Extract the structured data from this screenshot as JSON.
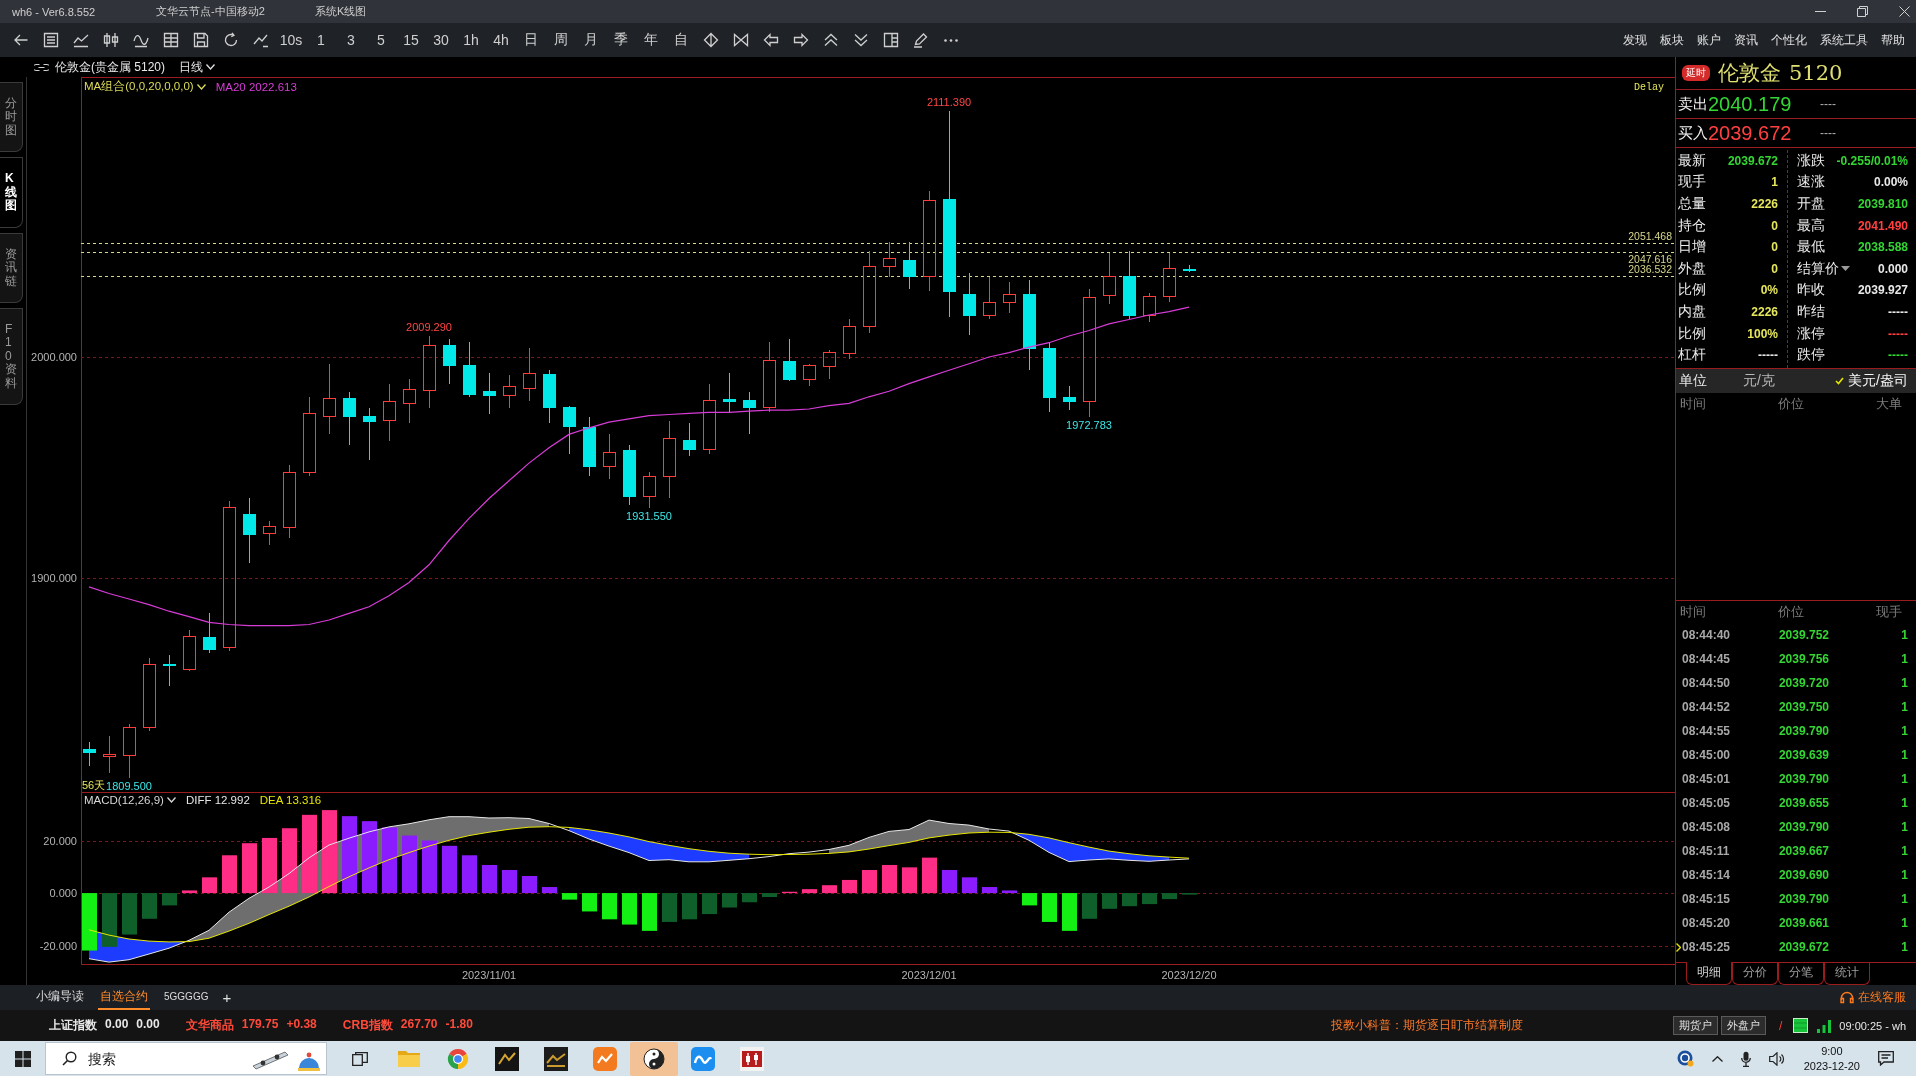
{
  "title_bar": {
    "app_version": "wh6 - Ver6.8.552",
    "server": "文华云节点-中国移动2",
    "window_title": "系统K线图"
  },
  "toolbar": {
    "intervals": [
      "10s",
      "1",
      "3",
      "5",
      "15",
      "30",
      "1h",
      "4h",
      "日",
      "周",
      "月",
      "季",
      "年",
      "自"
    ],
    "menu": [
      "发现",
      "板块",
      "账户",
      "资讯",
      "个性化",
      "系统工具",
      "帮助"
    ]
  },
  "chart": {
    "symbol": "伦敦金(贵金属 5120)",
    "period": "日线",
    "side_tabs": [
      {
        "label": "分时图",
        "selected": false
      },
      {
        "label": "K线图",
        "selected": true
      },
      {
        "label": "资讯链",
        "selected": false
      },
      {
        "label": "F10资料",
        "selected": false
      }
    ],
    "price_legend": {
      "indicator": "MA组合(0,0,20,0,0,0)",
      "readings": [
        "MA20 2022.613"
      ]
    },
    "macd_legend": {
      "indicator": "MACD(12,26,9)",
      "readings": [
        "DIFF 12.992",
        "DEA 13.316"
      ]
    },
    "chart_data": [
      {
        "type": "candlestick",
        "ylim": [
          1803.2,
          2126.7
        ],
        "yticks": [
          {
            "value": 1900,
            "label": "1900.000"
          },
          {
            "value": 2000,
            "label": "2000.000"
          }
        ],
        "grid": true,
        "ohlc": [
          [
            1822.5,
            1826,
            1815,
            1821.5
          ],
          [
            1819.5,
            1828.5,
            1812,
            1820.5
          ],
          [
            1820,
            1834,
            1809.5,
            1832.6
          ],
          [
            1832.6,
            1864,
            1831,
            1861
          ],
          [
            1861,
            1865,
            1851,
            1860.5
          ],
          [
            1859,
            1876.5,
            1858,
            1874
          ],
          [
            1873.5,
            1884,
            1866,
            1868
          ],
          [
            1869,
            1935,
            1867,
            1932
          ],
          [
            1929,
            1936,
            1907,
            1920
          ],
          [
            1920.5,
            1926,
            1915,
            1923.5
          ],
          [
            1923,
            1951,
            1918,
            1948
          ],
          [
            1948,
            1982,
            1946,
            1974.5
          ],
          [
            1973.5,
            1997,
            1965,
            1981.5
          ],
          [
            1981.5,
            1984,
            1960,
            1973.5
          ],
          [
            1973.5,
            1977,
            1953.5,
            1971
          ],
          [
            1971.5,
            1988,
            1962,
            1980
          ],
          [
            1979,
            1990,
            1970,
            1985.5
          ],
          [
            1985,
            2009.29,
            1977,
            2005.5
          ],
          [
            2005.5,
            2008,
            1988,
            1996.5
          ],
          [
            1996.5,
            2007,
            1982,
            1983.5
          ],
          [
            1984.5,
            1993,
            1974,
            1983
          ],
          [
            1983,
            1992,
            1977,
            1987
          ],
          [
            1986,
            2004,
            1980,
            1993
          ],
          [
            1992.5,
            1994,
            1970,
            1977.5
          ],
          [
            1977.5,
            1978,
            1956,
            1969
          ],
          [
            1968.5,
            1973,
            1946,
            1950.5
          ],
          [
            1950.5,
            1965,
            1945,
            1957
          ],
          [
            1958,
            1960,
            1933,
            1937
          ],
          [
            1937,
            1948,
            1931.55,
            1946
          ],
          [
            1946,
            1971,
            1936,
            1963.5
          ],
          [
            1962.5,
            1970,
            1955,
            1958.5
          ],
          [
            1958.5,
            1988,
            1956,
            1980.5
          ],
          [
            1981,
            1993,
            1975,
            1980
          ],
          [
            1980.5,
            1984,
            1965,
            1977.5
          ],
          [
            1977.5,
            2007,
            1975,
            1998.5
          ],
          [
            1998,
            2008,
            1989,
            1990
          ],
          [
            1990,
            1997,
            1987,
            1996.5
          ],
          [
            1996,
            2003,
            1990,
            2002.5
          ],
          [
            2002,
            2017,
            1999,
            2014
          ],
          [
            2014,
            2048,
            2011,
            2041
          ],
          [
            2041,
            2052,
            2036,
            2045
          ],
          [
            2044,
            2052,
            2031,
            2036.5
          ],
          [
            2036.5,
            2075,
            2030,
            2071
          ],
          [
            2071.5,
            2111.39,
            2018,
            2029.8
          ],
          [
            2028.5,
            2038,
            2010,
            2019
          ],
          [
            2019,
            2036,
            2017,
            2025
          ],
          [
            2025,
            2034,
            2020,
            2028.5
          ],
          [
            2028.5,
            2035,
            1994,
            2004
          ],
          [
            2004,
            2007,
            1975,
            1982
          ],
          [
            1982,
            1987,
            1976,
            1980
          ],
          [
            1980,
            2031,
            1972.783,
            2027
          ],
          [
            2028,
            2047,
            2024,
            2036.5
          ],
          [
            2036.5,
            2048,
            2017,
            2019
          ],
          [
            2019,
            2029,
            2016,
            2027.5
          ],
          [
            2027.5,
            2047,
            2025,
            2040.5
          ],
          [
            2039.81,
            2041.49,
            2038.588,
            2039.672
          ]
        ],
        "series": [
          {
            "type": "line",
            "color": "#d83cd8",
            "values": [
              1896,
              1893,
              1890.5,
              1888,
              1885,
              1882.5,
              1880,
              1879,
              1878.5,
              1878.5,
              1878.5,
              1879,
              1881,
              1884,
              1887,
              1892,
              1898,
              1906,
              1917,
              1927,
              1936,
              1944,
              1952,
              1959,
              1965,
              1968,
              1970.5,
              1972,
              1973.5,
              1974,
              1974.5,
              1975,
              1975,
              1975.5,
              1976,
              1976,
              1976.5,
              1978,
              1979,
              1982,
              1984.5,
              1988,
              1991,
              1994,
              1997,
              2000,
              2002,
              2004.5,
              2006.5,
              2009.5,
              2012,
              2015,
              2017,
              2019,
              2020.5,
              2022.6
            ]
          }
        ],
        "ref_lines": [
          {
            "axis": "y",
            "value": 2051.468,
            "label": "2051.468",
            "color": "#d6d68c",
            "line_style": "dashed"
          },
          {
            "axis": "y",
            "value": 2047.616,
            "label": "2047.616",
            "color": "#d6d68c",
            "line_style": "dashed"
          },
          {
            "axis": "y",
            "value": 2036.532,
            "label": "2036.532",
            "color": "#d6d68c",
            "line_style": "dashed"
          }
        ],
        "annotations": [
          "2111.390",
          "2009.290",
          "1931.550",
          "1972.783",
          "1809.500",
          "56天",
          "Delay"
        ]
      },
      {
        "type": "bar",
        "categories": [
          null,
          null,
          null,
          null,
          null,
          null,
          null,
          null,
          null,
          null,
          null,
          null,
          null,
          null,
          null,
          null,
          null,
          null,
          null,
          null,
          "2023/11/01",
          null,
          null,
          null,
          null,
          null,
          null,
          null,
          null,
          null,
          null,
          null,
          null,
          null,
          null,
          null,
          null,
          null,
          null,
          null,
          null,
          null,
          "2023/12/01",
          null,
          null,
          null,
          null,
          null,
          null,
          null,
          null,
          null,
          null,
          null,
          null,
          "2023/12/20"
        ],
        "ylim": [
          -27.4,
          38.5
        ],
        "yticks": [
          {
            "value": 20,
            "label": "20.000"
          },
          {
            "value": 0,
            "label": "0.000"
          },
          {
            "value": -20,
            "label": "-20.000"
          }
        ],
        "grid": true,
        "series": [
          {
            "values": [
              -21.9,
              -20.5,
              -15.8,
              -9.8,
              -4.7,
              1,
              6,
              14.4,
              19,
              21,
              24.7,
              29.8,
              31.6,
              29.3,
              27.4,
              25,
              21.9,
              20,
              18,
              14.4,
              10.7,
              8.8,
              6.5,
              2.3,
              -2.5,
              -7,
              -10,
              -12,
              -14.4,
              -11,
              -10,
              -8,
              -5.5,
              -3.5,
              -1.5,
              0.5,
              1.5,
              3,
              5,
              8.8,
              10.7,
              9.8,
              13.5,
              8.8,
              6,
              2.3,
              1,
              -4.7,
              -11,
              -14.4,
              -9.8,
              -6,
              -5,
              -4.2,
              -2.3,
              -0.6
            ],
            "colors": [
              "#14f014",
              "#0f5f2a",
              "#0f5f2a",
              "#0f5f2a",
              "#0f5f2a",
              "#ff2d86",
              "#ff2d86",
              "#ff2d86",
              "#ff2d86",
              "#ff2d86",
              "#ff2d86",
              "#ff2d86",
              "#ff2d86",
              "#8b1cff",
              "#8b1cff",
              "#8b1cff",
              "#8b1cff",
              "#8b1cff",
              "#8b1cff",
              "#8b1cff",
              "#8b1cff",
              "#8b1cff",
              "#8b1cff",
              "#8b1cff",
              "#14f014",
              "#14f014",
              "#14f014",
              "#14f014",
              "#14f014",
              "#0f5f2a",
              "#0f5f2a",
              "#0f5f2a",
              "#0f5f2a",
              "#0f5f2a",
              "#0f5f2a",
              "#ff2d86",
              "#ff2d86",
              "#ff2d86",
              "#ff2d86",
              "#ff2d86",
              "#ff2d86",
              "#ff2d86",
              "#ff2d86",
              "#8b1cff",
              "#8b1cff",
              "#8b1cff",
              "#8b1cff",
              "#14f014",
              "#14f014",
              "#14f014",
              "#0f5f2a",
              "#0f5f2a",
              "#0f5f2a",
              "#0f5f2a",
              "#0f5f2a",
              "#0f5f2a"
            ]
          },
          {
            "type": "line",
            "color": "#e6e6e6",
            "values": [
              -25,
              -26.3,
              -25.4,
              -23.2,
              -21,
              -18,
              -14.2,
              -7.3,
              -2,
              2.3,
              7.4,
              13.4,
              18.3,
              20.9,
              23.3,
              25.2,
              26.4,
              27.9,
              29.1,
              29.1,
              28.6,
              28.7,
              28.4,
              26.5,
              23.8,
              20.6,
              17.9,
              15.4,
              12.4,
              12.7,
              11.9,
              11.9,
              12.5,
              13.1,
              13.9,
              15,
              15.6,
              16.6,
              18.2,
              21.2,
              23.5,
              24.2,
              27.8,
              26.5,
              25.9,
              24.4,
              23.6,
              20.1,
              15.5,
              12,
              12.6,
              13,
              12.5,
              12.1,
              12.6,
              13
            ]
          },
          {
            "type": "line",
            "color": "#e6e600",
            "values": [
              -14,
              -16,
              -17.5,
              -18.3,
              -18.6,
              -18.5,
              -17.2,
              -14.5,
              -11.5,
              -8.2,
              -5,
              -1.5,
              2.5,
              6.2,
              9.6,
              12.7,
              15.4,
              17.9,
              20.1,
              21.9,
              23.2,
              24.3,
              25.1,
              25.3,
              25,
              24.1,
              22.9,
              21.4,
              19.6,
              18.2,
              16.9,
              15.9,
              15.2,
              14.8,
              14.6,
              14.7,
              14.8,
              15.1,
              15.7,
              16.8,
              18.1,
              19.3,
              21,
              22.1,
              22.9,
              23.2,
              23.1,
              22.4,
              21,
              19.2,
              17.5,
              16,
              15,
              14.2,
              13.7,
              13.3
            ]
          }
        ]
      }
    ]
  },
  "quote_panel": {
    "badge": "延时",
    "name": "伦敦金",
    "code": "5120",
    "quotes": [
      {
        "label": "卖出",
        "price": "2040.179",
        "size": "----",
        "color": "#33d633"
      },
      {
        "label": "买入",
        "price": "2039.672",
        "size": "----",
        "color": "#ff4040"
      }
    ],
    "left_stats": [
      {
        "label": "最新",
        "value": "2039.672",
        "color": "#33d633"
      },
      {
        "label": "现手",
        "value": "1",
        "color": "#e6e65c"
      },
      {
        "label": "总量",
        "value": "2226",
        "color": "#e6e65c"
      },
      {
        "label": "持仓",
        "value": "0",
        "color": "#e6e65c"
      },
      {
        "label": "日增",
        "value": "0",
        "color": "#e6e65c"
      },
      {
        "label": "外盘",
        "value": "0",
        "color": "#e6e65c"
      },
      {
        "label": "比例",
        "value": "0%",
        "color": "#e6e65c"
      },
      {
        "label": "内盘",
        "value": "2226",
        "color": "#e6e65c"
      },
      {
        "label": "比例",
        "value": "100%",
        "color": "#e6e65c"
      },
      {
        "label": "杠杆",
        "value": "-----",
        "color": "#e8e8e8"
      }
    ],
    "right_stats": [
      {
        "label": "涨跌",
        "value": "-0.255/0.01%",
        "color": "#33d633",
        "kind": "plain"
      },
      {
        "label": "速涨",
        "value": "0.00%",
        "color": "#e8e8e8",
        "kind": "plain"
      },
      {
        "label": "开盘",
        "value": "2039.810",
        "color": "#33d633",
        "kind": "plain"
      },
      {
        "label": "最高",
        "value": "2041.490",
        "color": "#ff4040",
        "kind": "plain"
      },
      {
        "label": "最低",
        "value": "2038.588",
        "color": "#33d633",
        "kind": "plain"
      },
      {
        "label": "结算价",
        "value": "0.000",
        "color": "#e8e8e8",
        "kind": "dropdown"
      },
      {
        "label": "昨收",
        "value": "2039.927",
        "color": "#e8e8e8",
        "kind": "plain"
      },
      {
        "label": "昨结",
        "value": "-----",
        "color": "#e8e8e8",
        "kind": "plain"
      },
      {
        "label": "涨停",
        "value": "-----",
        "color": "#ff4040",
        "kind": "plain"
      },
      {
        "label": "跌停",
        "value": "-----",
        "color": "#33d633",
        "kind": "plain"
      }
    ],
    "units": {
      "label": "单位",
      "options": [
        {
          "label": "元/克",
          "selected": false
        },
        {
          "label": "美元/盎司",
          "selected": true
        }
      ]
    },
    "big_orders": {
      "columns": [
        "时间",
        "价位",
        "大单"
      ]
    },
    "ticks": {
      "columns": [
        "时间",
        "价位",
        "现手"
      ],
      "rows": [
        {
          "time": "08:44:40",
          "price": "2039.752",
          "volume": "1",
          "selected": false
        },
        {
          "time": "08:44:45",
          "price": "2039.756",
          "volume": "1",
          "selected": false
        },
        {
          "time": "08:44:50",
          "price": "2039.720",
          "volume": "1",
          "selected": false
        },
        {
          "time": "08:44:52",
          "price": "2039.750",
          "volume": "1",
          "selected": false
        },
        {
          "time": "08:44:55",
          "price": "2039.790",
          "volume": "1",
          "selected": false
        },
        {
          "time": "08:45:00",
          "price": "2039.639",
          "volume": "1",
          "selected": false
        },
        {
          "time": "08:45:01",
          "price": "2039.790",
          "volume": "1",
          "selected": false
        },
        {
          "time": "08:45:05",
          "price": "2039.655",
          "volume": "1",
          "selected": false
        },
        {
          "time": "08:45:08",
          "price": "2039.790",
          "volume": "1",
          "selected": false
        },
        {
          "time": "08:45:11",
          "price": "2039.667",
          "volume": "1",
          "selected": false
        },
        {
          "time": "08:45:14",
          "price": "2039.690",
          "volume": "1",
          "selected": false
        },
        {
          "time": "08:45:15",
          "price": "2039.790",
          "volume": "1",
          "selected": false
        },
        {
          "time": "08:45:20",
          "price": "2039.661",
          "volume": "1",
          "selected": false
        },
        {
          "time": "08:45:25",
          "price": "2039.672",
          "volume": "1",
          "selected": true
        }
      ]
    },
    "tabs": [
      {
        "label": "明细",
        "selected": true
      },
      {
        "label": "分价",
        "selected": false
      },
      {
        "label": "分笔",
        "selected": false
      },
      {
        "label": "统计",
        "selected": false
      }
    ]
  },
  "bottom_bar": {
    "tabs": [
      {
        "label": "小编导读",
        "selected": false
      },
      {
        "label": "自选合约",
        "selected": true
      },
      {
        "label": "5GGGGG",
        "selected": false
      }
    ],
    "add_button": "+",
    "support": "在线客服"
  },
  "ticker": {
    "indices": [
      {
        "name": "上证指数",
        "value": "0.00",
        "change": "0.00",
        "color": "#e8e8e8"
      },
      {
        "name": "文华商品",
        "value": "179.75",
        "change": "+0.38",
        "color": "#ff4a3a"
      },
      {
        "name": "CRB指数",
        "value": "267.70",
        "change": "-1.80",
        "color": "#ff4a3a"
      }
    ],
    "notice": "投教小科普：期货逐日盯市结算制度",
    "accounts": [
      "期货户",
      "外盘户"
    ],
    "separator": "/",
    "time": "09:00:25 - wh"
  },
  "taskbar": {
    "search_placeholder": "搜索",
    "apps": [
      {
        "selected": false
      },
      {
        "selected": false
      },
      {
        "selected": false
      },
      {
        "selected": false
      },
      {
        "selected": false
      },
      {
        "selected": true
      },
      {
        "selected": false
      },
      {
        "selected": false
      }
    ],
    "clock_time": "9:00",
    "clock_date": "2023-12-20"
  }
}
